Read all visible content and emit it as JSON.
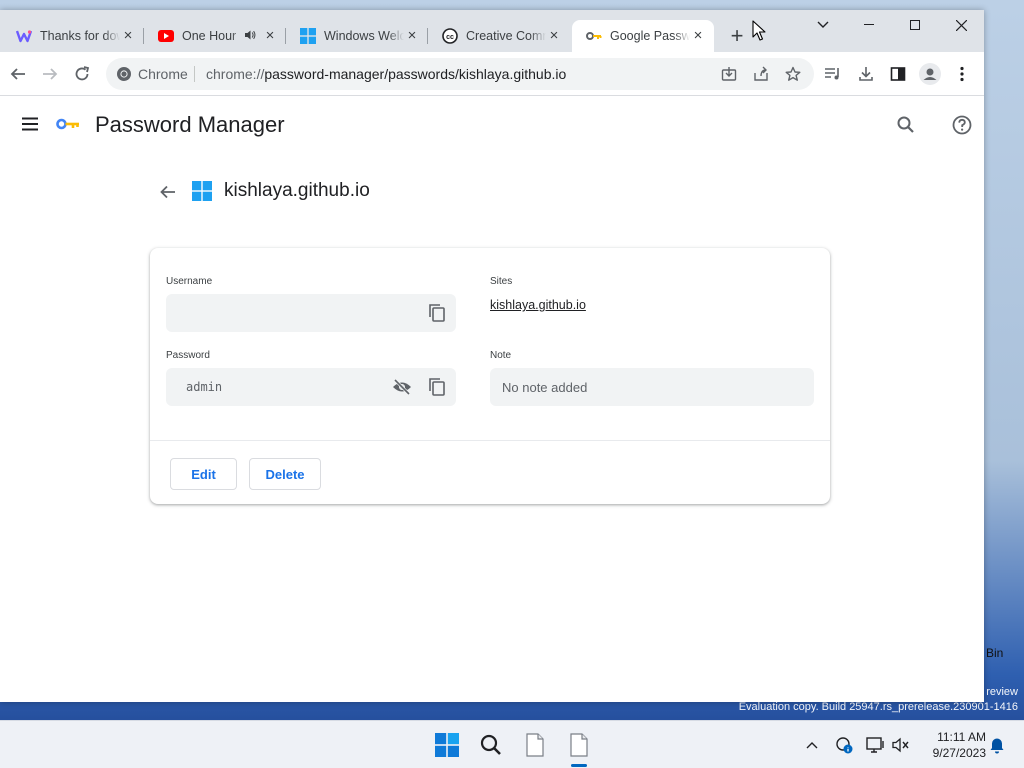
{
  "browser": {
    "tabs": [
      {
        "title": "Thanks for downloading",
        "icon": "w-logo-icon",
        "active": false
      },
      {
        "title": "One Hour",
        "icon": "youtube-icon",
        "active": false,
        "audio": true
      },
      {
        "title": "Windows Welcome",
        "icon": "windows-logo-icon",
        "active": false
      },
      {
        "title": "Creative Commons",
        "icon": "cc-icon",
        "active": false
      },
      {
        "title": "Google Password Manager",
        "icon": "key-icon",
        "active": true
      }
    ],
    "new_tab": "+",
    "omnibox": {
      "chip_label": "Chrome",
      "url_scheme": "chrome://",
      "url_rest": "password-manager/passwords/kishlaya.github.io"
    }
  },
  "password_manager": {
    "title": "Password Manager",
    "site_title": "kishlaya.github.io",
    "username_label": "Username",
    "username_value": "",
    "password_label": "Password",
    "password_value": "admin",
    "sites_label": "Sites",
    "site_link": "kishlaya.github.io",
    "note_label": "Note",
    "note_placeholder": "No note added",
    "edit_label": "Edit",
    "delete_label": "Delete"
  },
  "desktop": {
    "icon_label": "Bin",
    "watermark_line1": "review",
    "watermark_line2": "Evaluation copy. Build 25947.rs_prerelease.230901-1416"
  },
  "taskbar": {
    "time": "11:11 AM",
    "date": "9/27/2023"
  },
  "colors": {
    "accent": "#1a73e8",
    "tab_strip": "#dfe3e8",
    "field_bg": "#f1f3f4"
  }
}
